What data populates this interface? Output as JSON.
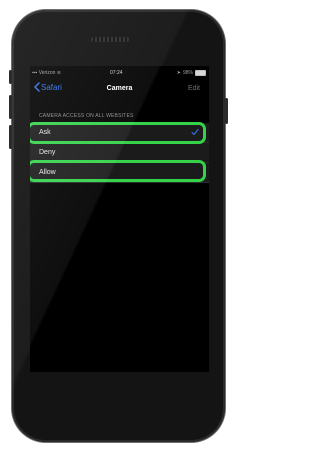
{
  "status_bar": {
    "carrier": "Verizon",
    "time": "07:24",
    "battery": "98%"
  },
  "nav": {
    "back_label": "Safari",
    "title": "Camera",
    "edit_label": "Edit"
  },
  "section": {
    "label": "CAMERA ACCESS ON ALL WEBSITES"
  },
  "options": [
    {
      "label": "Ask",
      "selected": true
    },
    {
      "label": "Deny",
      "selected": false
    },
    {
      "label": "Allow",
      "selected": false
    }
  ],
  "colors": {
    "accent": "#2f6fe7",
    "highlight": "#34d34a"
  }
}
